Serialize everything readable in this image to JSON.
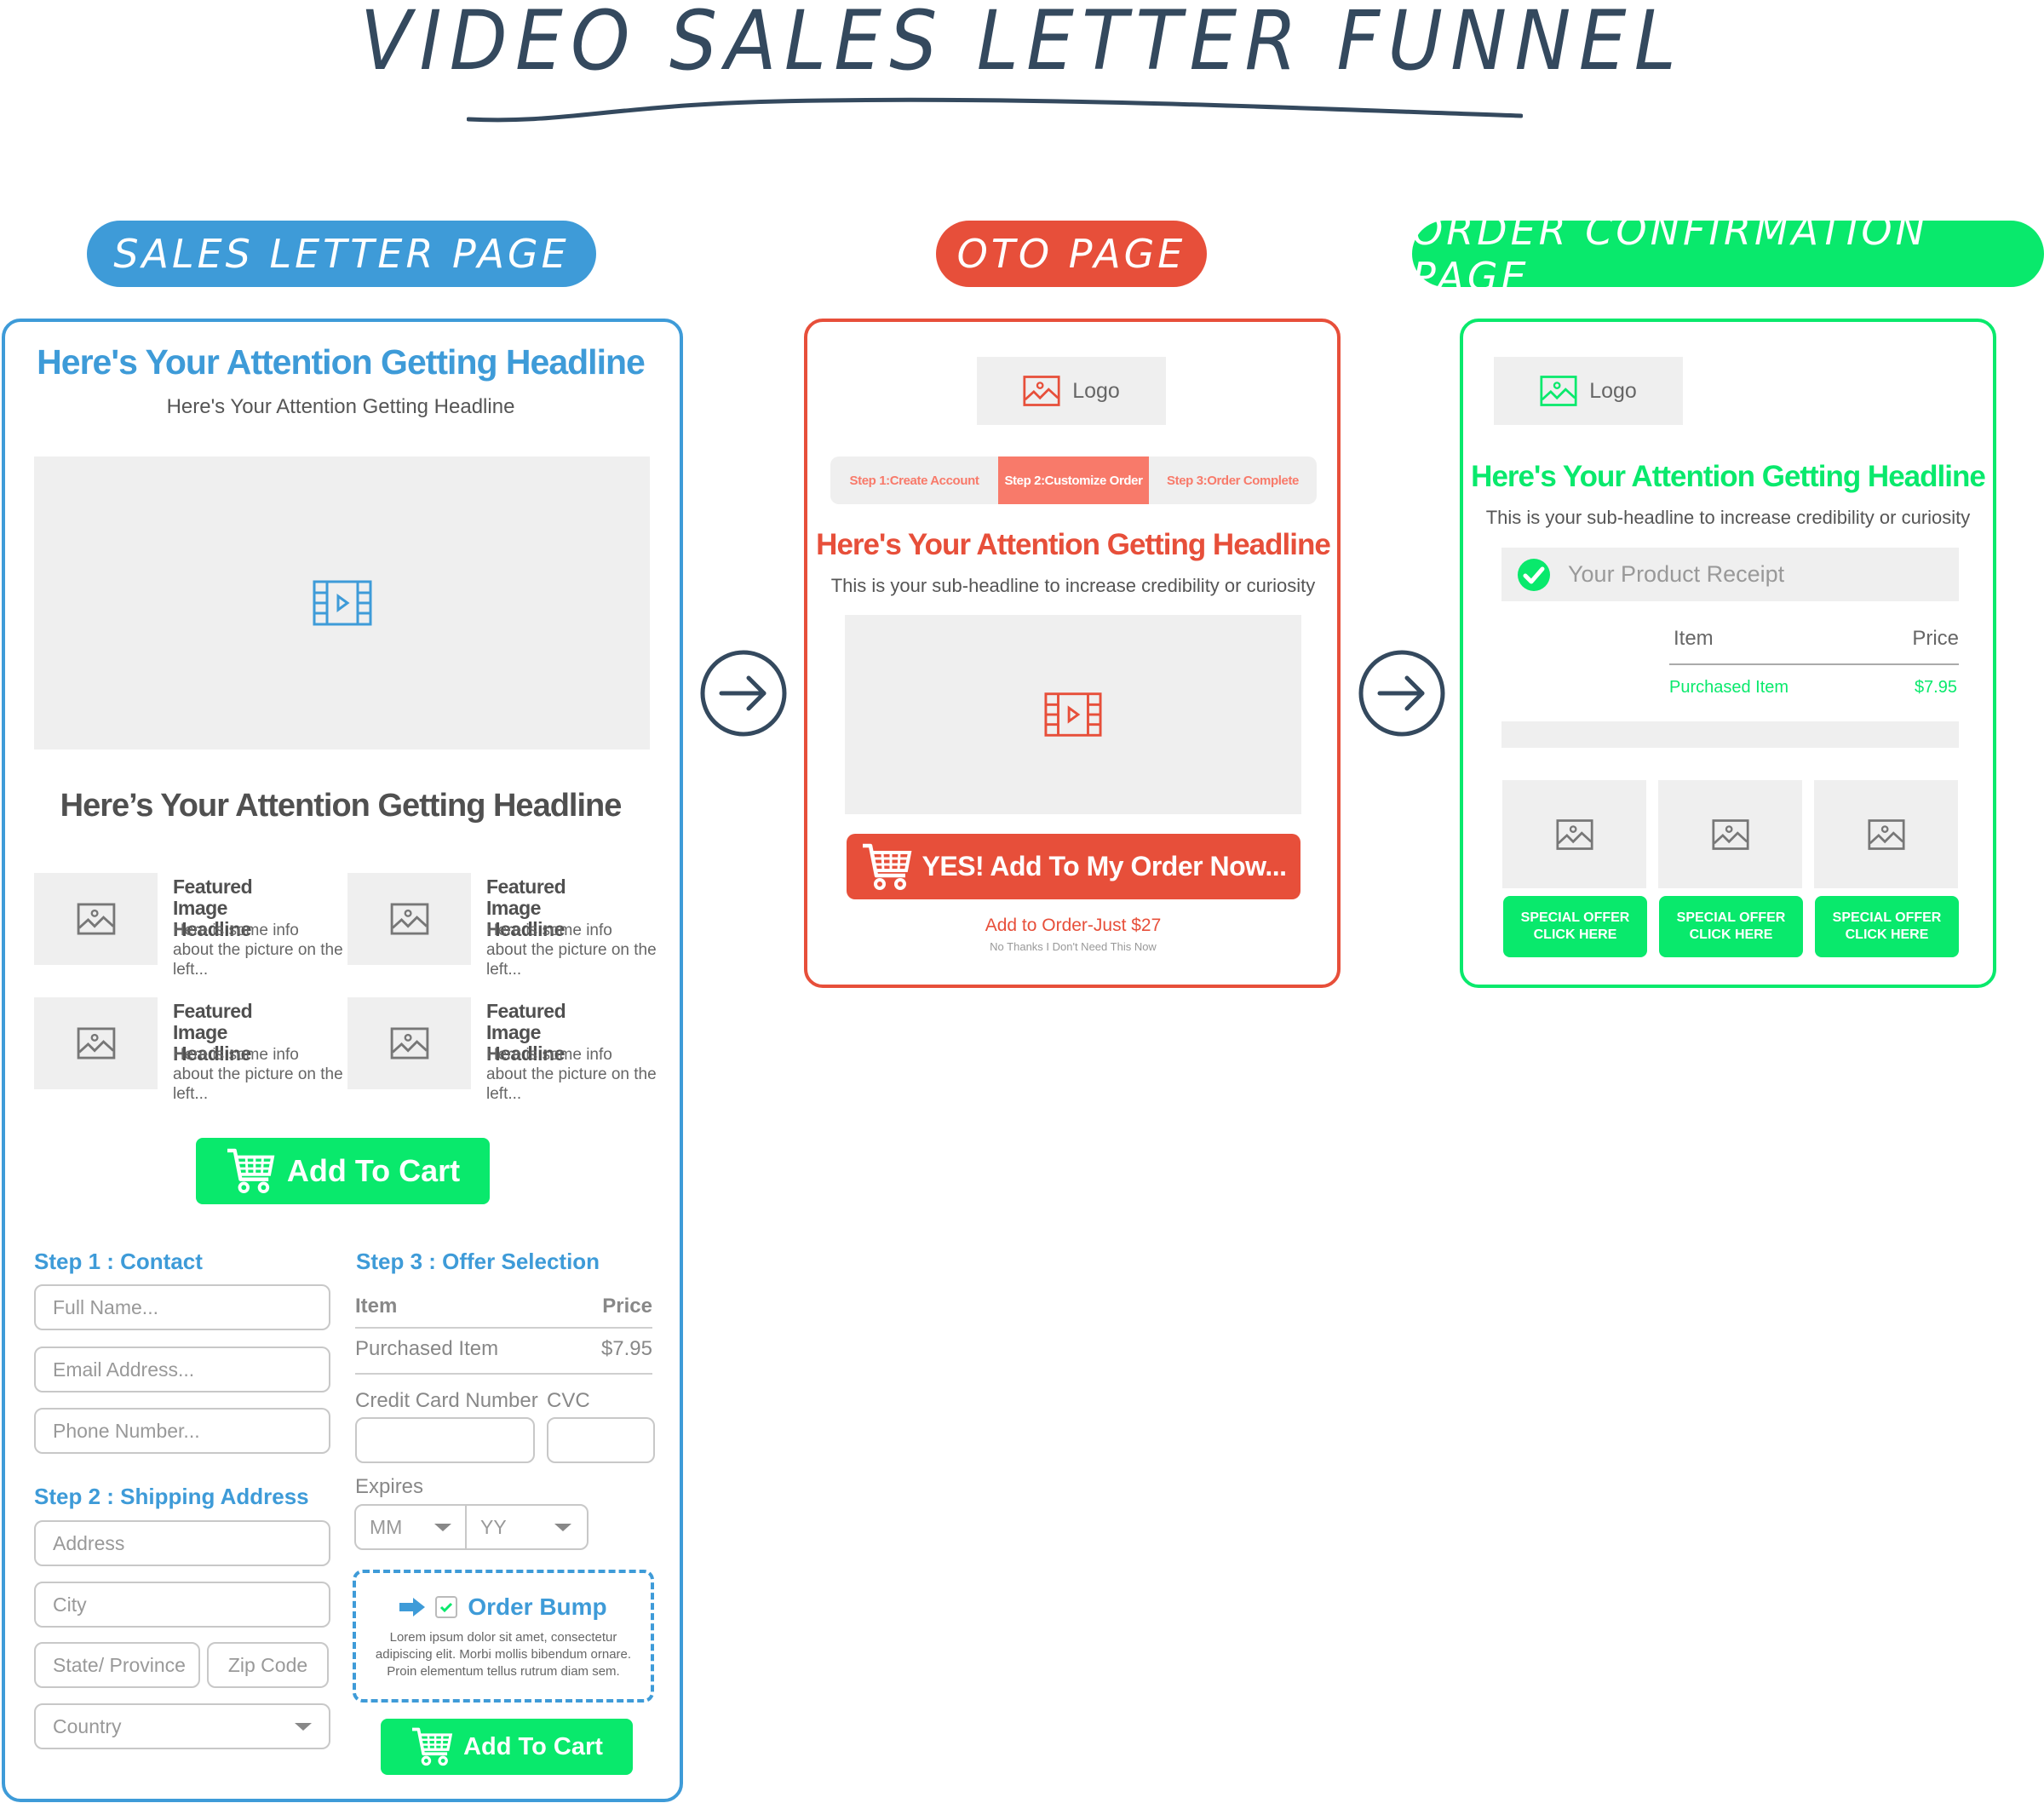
{
  "title": "VIDEO SALES LETTER FUNNEL",
  "colors": {
    "blue": "#3e9bd8",
    "red": "#e74f3a",
    "green": "#09e96c",
    "navy": "#34495e",
    "placeholder_grey": "#efefef"
  },
  "flow": {
    "arrows": [
      {
        "icon": "arrow-right-circle-icon"
      },
      {
        "icon": "arrow-right-circle-icon"
      }
    ]
  },
  "sales_letter": {
    "badge": "SALES LETTER PAGE",
    "headline": "Here's Your Attention Getting Headline",
    "subheadline": "Here's Your Attention Getting Headline",
    "video_icon": "video-play-icon",
    "headline2": "Here’s Your Attention Getting Headline",
    "features": [
      {
        "title": "Featured Image Headline",
        "text": "Here is some info about the picture on the left..."
      },
      {
        "title": "Featured Image Headline",
        "text": "Here is some info about the picture on the left..."
      },
      {
        "title": "Featured Image Headline",
        "text": "Here is some info about the picture on the left..."
      },
      {
        "title": "Featured Image Headline",
        "text": "Here is some info about the picture on the left..."
      }
    ],
    "add_to_cart": "Add To Cart",
    "step1": {
      "title": "Step 1 : Contact",
      "fields": [
        "Full Name...",
        "Email Address...",
        "Phone Number..."
      ]
    },
    "step2": {
      "title": "Step 2 : Shipping Address",
      "address": "Address",
      "city": "City",
      "state": "State/ Province",
      "zip": "Zip Code",
      "country": "Country"
    },
    "step3": {
      "title": "Step 3 : Offer Selection",
      "col_item": "Item",
      "col_price": "Price",
      "item": "Purchased Item",
      "price": "$7.95",
      "cc_label": "Credit Card Number",
      "cvc_label": "CVC",
      "expires_label": "Expires",
      "mm": "MM",
      "yy": "YY"
    },
    "order_bump": {
      "title": "Order Bump",
      "checked": true,
      "text": "Lorem ipsum dolor sit amet, consectetur adipiscing elit. Morbi mollis bibendum ornare. Proin elementum tellus rutrum diam sem."
    },
    "add_to_cart_2": "Add To Cart"
  },
  "oto": {
    "badge": "OTO PAGE",
    "logo": "Logo",
    "steps": [
      {
        "label": "Step 1:Create Account",
        "active": false
      },
      {
        "label": "Step 2:Customize Order",
        "active": true
      },
      {
        "label": "Step 3:Order Complete",
        "active": false
      }
    ],
    "headline": "Here's Your Attention Getting Headline",
    "subheadline": "This is your sub-headline to increase credibility or curiosity",
    "cta": "YES! Add To My Order Now...",
    "price_text": "Add to Order-Just $27",
    "no_thanks": "No Thanks I Don't Need This Now"
  },
  "confirmation": {
    "badge": "ORDER CONFIRMATION PAGE",
    "logo": "Logo",
    "headline": "Here's Your Attention Getting Headline",
    "subheadline": "This is your sub-headline to increase credibility or curiosity",
    "receipt_label": "Your Product Receipt",
    "col_item": "Item",
    "col_price": "Price",
    "item": "Purchased Item",
    "price": "$7.95",
    "offers": [
      {
        "line1": "SPECIAL OFFER",
        "line2": "CLICK HERE"
      },
      {
        "line1": "SPECIAL OFFER",
        "line2": "CLICK HERE"
      },
      {
        "line1": "SPECIAL OFFER",
        "line2": "CLICK HERE"
      }
    ]
  }
}
